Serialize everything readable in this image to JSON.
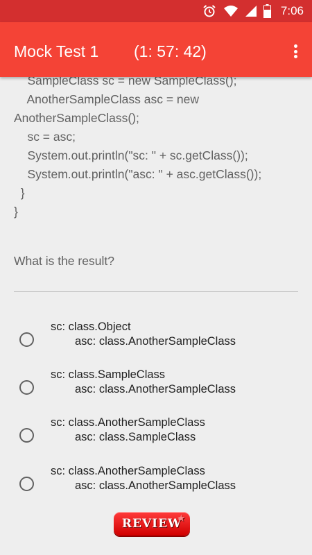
{
  "status_bar": {
    "time": "7:06",
    "icons": [
      "alarm-icon",
      "wifi-icon",
      "signal-icon",
      "battery-icon"
    ]
  },
  "app_bar": {
    "title": "Mock Test 1",
    "timer": "(1: 57: 42)",
    "menu_icon": "overflow-menu-icon"
  },
  "code_lines": [
    "    SampleClass sc = new SampleClass();",
    "    AnotherSampleClass asc = new",
    "AnotherSampleClass();",
    "    sc = asc;",
    "    System.out.println(\"sc: \" + sc.getClass());",
    "    System.out.println(\"asc: \" + asc.getClass());",
    "  }",
    "}"
  ],
  "question": "What is the result?",
  "options": [
    {
      "line1": "sc: class.Object",
      "line2": "asc: class.AnotherSampleClass"
    },
    {
      "line1": "sc: class.SampleClass",
      "line2": "asc: class.AnotherSampleClass"
    },
    {
      "line1": "sc: class.AnotherSampleClass",
      "line2": "asc: class.SampleClass"
    },
    {
      "line1": "sc: class.AnotherSampleClass",
      "line2": "asc: class.AnotherSampleClass"
    }
  ],
  "review_button": {
    "label": "REVIEW"
  },
  "colors": {
    "status_bar": "#d32f2f",
    "app_bar": "#f44336",
    "background": "#eeeeee",
    "review": "#e31b1b"
  }
}
